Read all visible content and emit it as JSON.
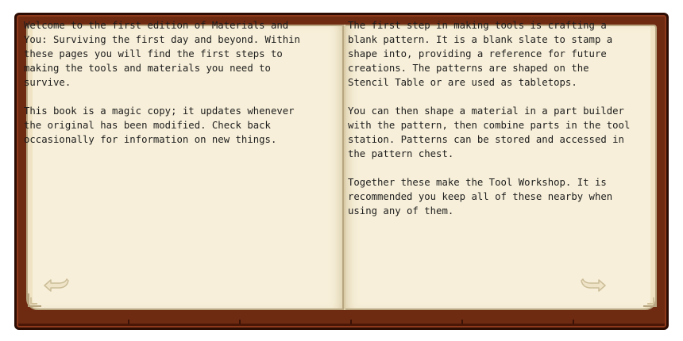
{
  "book": {
    "left_page": {
      "paragraphs": [
        "Welcome to the first edition of Materials and You: Surviving the first day and beyond. Within these pages you will find the first steps to making the tools and materials you need to survive.",
        "This book is a magic copy; it updates whenever the original has been modified. Check back occasionally for information on new things."
      ]
    },
    "right_page": {
      "paragraphs": [
        "The first step in making tools is crafting a blank pattern. It is a blank slate to stamp a shape into, providing a reference for future creations. The patterns are shaped on the Stencil Table or are used as tabletops.",
        "You can then shape a material in a part builder with the pattern, then combine parts in the tool station. Patterns can be stored and accessed in the pattern chest.",
        "Together these make the Tool Workshop. It is recommended you keep all of these nearby when using any of them."
      ]
    },
    "navigation": {
      "prev_icon": "arrow-left-icon",
      "next_icon": "arrow-right-icon"
    },
    "colors": {
      "cover": "#6f2a12",
      "cover_border": "#2b0d04",
      "page": "#f7efd9",
      "text": "#1d1d1d",
      "arrow": "#d8ccae"
    }
  }
}
